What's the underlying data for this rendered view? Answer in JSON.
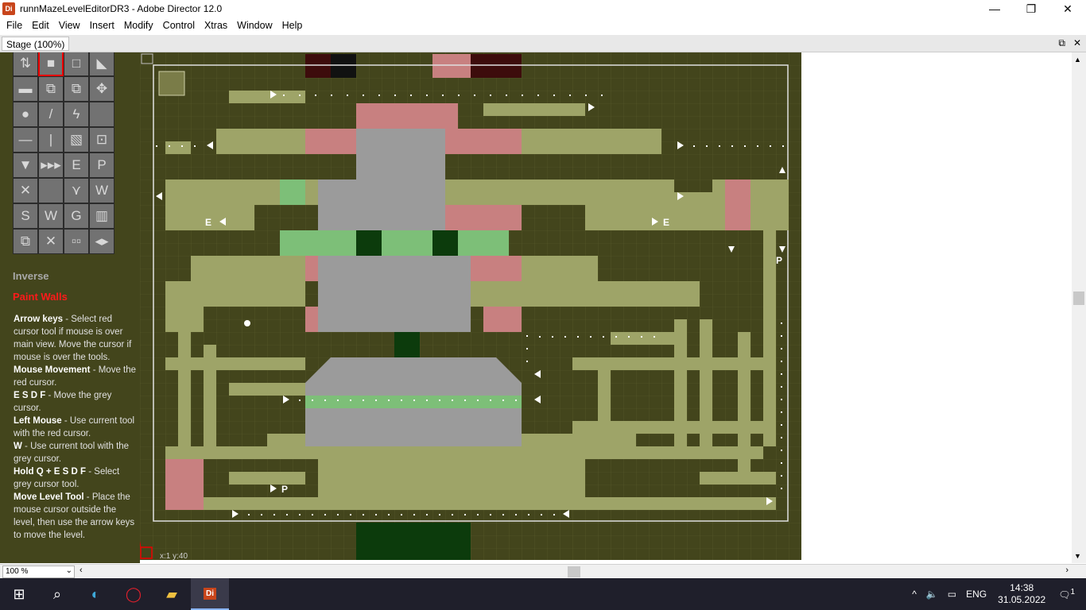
{
  "window": {
    "title": "runnMazeLevelEditorDR3 - Adobe Director 12.0",
    "app_icon": "Di"
  },
  "menubar": [
    "File",
    "Edit",
    "View",
    "Insert",
    "Modify",
    "Control",
    "Xtras",
    "Window",
    "Help"
  ],
  "stage_tab": "Stage (100%)",
  "tools": [
    [
      "⇅",
      "■",
      "□",
      "◣"
    ],
    [
      "▬",
      "⧉",
      "⧉",
      "✥"
    ],
    [
      "●",
      "/",
      "ϟ",
      ""
    ],
    [
      "—",
      "|",
      "▧",
      "⊡"
    ],
    [
      "▼",
      "▸▸▸",
      "E",
      "P"
    ],
    [
      "✕",
      "",
      "⋎",
      "W"
    ],
    [
      "S",
      "W",
      "G",
      "▥"
    ],
    [
      "⧉",
      "✕",
      "▫▫",
      "◂▸"
    ]
  ],
  "panel": {
    "inverse": "Inverse",
    "mode": "Paint Walls",
    "help": [
      {
        "key": "Arrow keys",
        "text": " - Select red cursor tool if mouse is over main view. Move the cursor if mouse is over the tools."
      },
      {
        "key": "Mouse Movement",
        "text": " - Move the red cursor."
      },
      {
        "key": "E S D F",
        "text": " - Move the grey cursor."
      },
      {
        "key": "Left Mouse",
        "text": " - Use current tool with the red cursor."
      },
      {
        "key": "W",
        "text": " - Use current tool with the grey cursor."
      },
      {
        "key": "Hold Q + E S D F",
        "text": " - Select grey cursor tool."
      },
      {
        "key": "Move Level Tool",
        "text": " - Place the mouse cursor outside the level, then use the arrow keys to move the level."
      }
    ]
  },
  "map": {
    "coord": "x:1 y:40",
    "markers": [
      "E",
      "E",
      "P",
      "P"
    ]
  },
  "bottom": {
    "zoom": "100 %"
  },
  "taskbar": {
    "lang": "ENG",
    "time": "14:38",
    "date": "31.05.2022",
    "notifications": "1"
  },
  "colors": {
    "dark": "#43451c",
    "olive": "#9ea468",
    "grey": "#9b9b9b",
    "pink": "#c88080",
    "green": "#7dbf78",
    "darkgreen": "#0c3b0c"
  }
}
